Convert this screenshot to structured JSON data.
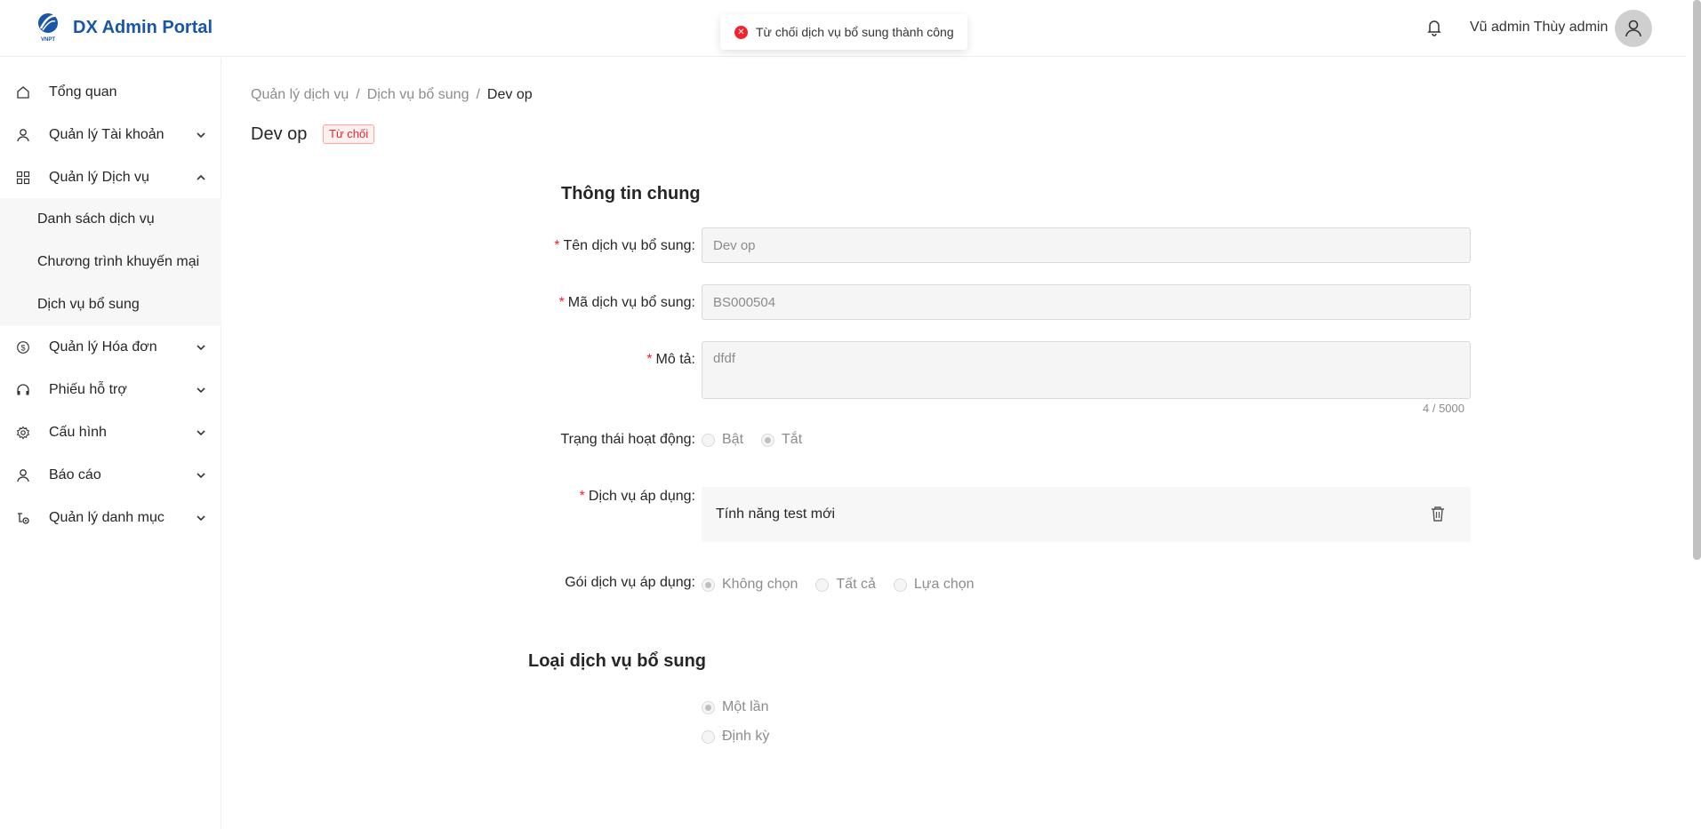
{
  "header": {
    "app_title": "DX Admin Portal",
    "logo_text": "VNPT",
    "user_name": "Vũ admin Thùy admin"
  },
  "toast": {
    "message": "Từ chối dịch vụ bổ sung thành công",
    "type": "error"
  },
  "sidebar": {
    "items": [
      {
        "label": "Tổng quan",
        "icon": "home-icon"
      },
      {
        "label": "Quản lý Tài khoản",
        "icon": "user-icon",
        "expanded": false
      },
      {
        "label": "Quản lý Dịch vụ",
        "icon": "grid-icon",
        "expanded": true
      },
      {
        "label": "Quản lý Hóa đơn",
        "icon": "dollar-icon",
        "expanded": false
      },
      {
        "label": "Phiếu hỗ trợ",
        "icon": "headset-icon",
        "expanded": false
      },
      {
        "label": "Cấu hình",
        "icon": "gear-icon",
        "expanded": false
      },
      {
        "label": "Báo cáo",
        "icon": "user-icon",
        "expanded": false
      },
      {
        "label": "Quản lý danh mục",
        "icon": "category-icon",
        "expanded": false
      }
    ],
    "subitems": [
      {
        "label": "Danh sách dịch vụ"
      },
      {
        "label": "Chương trình khuyến mại"
      },
      {
        "label": "Dịch vụ bổ sung"
      }
    ]
  },
  "breadcrumb": {
    "level1": "Quản lý dịch vụ",
    "level2": "Dịch vụ bổ sung",
    "current": "Dev op",
    "separator": "/"
  },
  "page": {
    "title": "Dev op",
    "status": "Từ chối"
  },
  "form": {
    "section_general": "Thông tin chung",
    "name_label": "Tên dịch vụ bổ sung",
    "name_value": "Dev op",
    "code_label": "Mã dịch vụ bổ sung",
    "code_value": "BS000504",
    "desc_label": "Mô tả",
    "desc_value": "dfdf",
    "desc_counter": "4 / 5000",
    "status_label": "Trạng thái hoạt động",
    "status_on": "Bật",
    "status_off": "Tắt",
    "status_selected": "Tắt",
    "service_label": "Dịch vụ áp dụng",
    "service_value": "Tính năng test mới",
    "package_label": "Gói dịch vụ áp dụng",
    "package_none": "Không chọn",
    "package_all": "Tất cả",
    "package_choose": "Lựa chọn",
    "package_selected": "Không chọn",
    "section_type": "Loại dịch vụ bổ sung",
    "type_once": "Một lần",
    "type_periodic": "Định kỳ",
    "type_selected": "Một lần",
    "colon": ":"
  },
  "colors": {
    "brand": "#1a56a8",
    "error": "#f5222d"
  }
}
